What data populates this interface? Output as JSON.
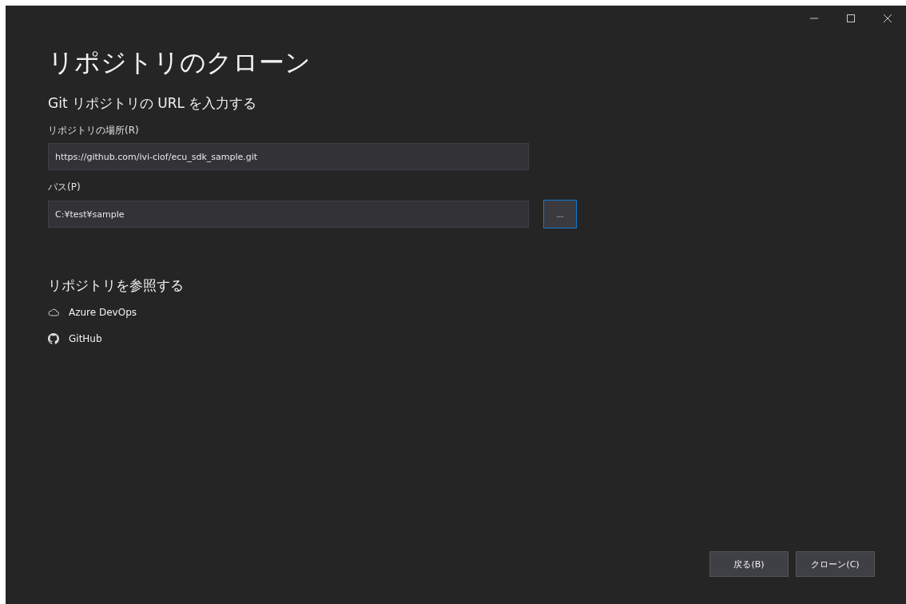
{
  "window": {
    "title": "リポジトリのクローン",
    "controls": [
      {
        "kind": "minimize"
      },
      {
        "kind": "maximize"
      },
      {
        "kind": "close"
      }
    ]
  },
  "url_section": {
    "heading": "Git リポジトリの URL を入力する",
    "fields": [
      {
        "label": "リポジトリの場所(R)",
        "value": "https://github.com/ivi-ciof/ecu_sdk_sample.git"
      },
      {
        "label": "パス(P)",
        "value": "C:¥test¥sample",
        "browse": "..."
      }
    ]
  },
  "browse_section": {
    "heading": "リポジトリを参照する",
    "items": [
      {
        "kind": "cloud",
        "label": "Azure DevOps"
      },
      {
        "kind": "github",
        "label": "GitHub"
      }
    ]
  },
  "buttons": [
    {
      "label": "戻る(B)"
    },
    {
      "label": "クローン(C)"
    }
  ]
}
